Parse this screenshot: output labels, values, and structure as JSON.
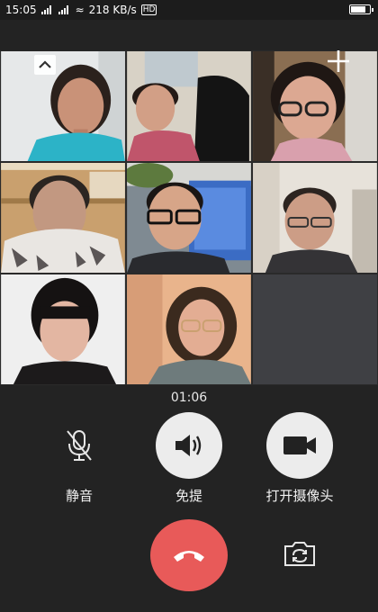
{
  "status_bar": {
    "time": "15:05",
    "network_speed": "218 KB/s",
    "network_tag": "HD"
  },
  "call": {
    "duration": "01:06"
  },
  "controls": {
    "mute_label": "静音",
    "speaker_label": "免提",
    "camera_label": "打开摄像头"
  },
  "participants": [
    {
      "position": "row1-col1"
    },
    {
      "position": "row1-col2"
    },
    {
      "position": "row1-col3"
    },
    {
      "position": "row2-col1"
    },
    {
      "position": "row2-col2"
    },
    {
      "position": "row2-col3"
    },
    {
      "position": "row3-col1"
    },
    {
      "position": "row3-col2"
    }
  ],
  "icons": {
    "collapse": "chevron-up-icon",
    "add": "plus-icon",
    "mute": "microphone-off-icon",
    "speaker": "speaker-icon",
    "camera": "video-camera-icon",
    "hangup": "phone-hangup-icon",
    "flip": "switch-camera-icon"
  },
  "colors": {
    "background": "#232323",
    "hangup": "#e85a59",
    "button_light": "#ececec",
    "empty_tile": "#3f4044"
  }
}
